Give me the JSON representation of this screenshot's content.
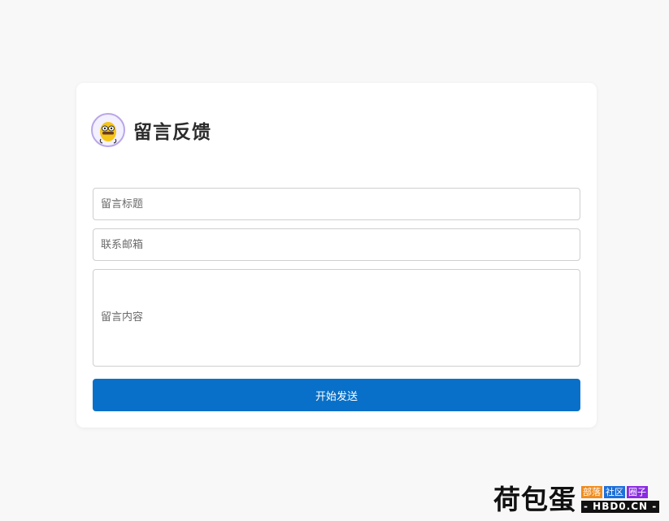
{
  "form": {
    "heading": "留言反馈",
    "title_placeholder": "留言标题",
    "email_placeholder": "联系邮箱",
    "content_placeholder": "留言内容",
    "submit_label": "开始发送",
    "accent_color": "#0870c8"
  },
  "avatar": {
    "icon": "duck-mascot-icon"
  },
  "watermark": {
    "brand": "荷包蛋",
    "tags": [
      {
        "label": "部落",
        "color": "#f08c1e"
      },
      {
        "label": "社区",
        "color": "#1e6fd9"
      },
      {
        "label": "圈子",
        "color": "#8a2be2"
      }
    ],
    "domain": "- HBD0.CN -"
  }
}
